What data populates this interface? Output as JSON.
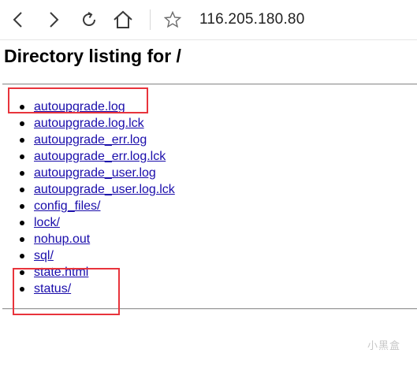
{
  "toolbar": {
    "back_icon": "back-arrow-icon",
    "forward_icon": "forward-arrow-icon",
    "refresh_icon": "refresh-icon",
    "home_icon": "home-icon",
    "favorite_icon": "star-icon",
    "address": "116.205.180.80"
  },
  "page": {
    "title": "Directory listing for /"
  },
  "listing": {
    "items": [
      {
        "label": "autoupgrade.log"
      },
      {
        "label": "autoupgrade.log.lck"
      },
      {
        "label": "autoupgrade_err.log"
      },
      {
        "label": "autoupgrade_err.log.lck"
      },
      {
        "label": "autoupgrade_user.log"
      },
      {
        "label": "autoupgrade_user.log.lck"
      },
      {
        "label": "config_files/"
      },
      {
        "label": "lock/"
      },
      {
        "label": "nohup.out"
      },
      {
        "label": "sql/"
      },
      {
        "label": "state.html"
      },
      {
        "label": "status/"
      }
    ]
  },
  "annotations": {
    "highlight_color": "#e8343c"
  },
  "watermark": {
    "text": "小黑盒"
  }
}
